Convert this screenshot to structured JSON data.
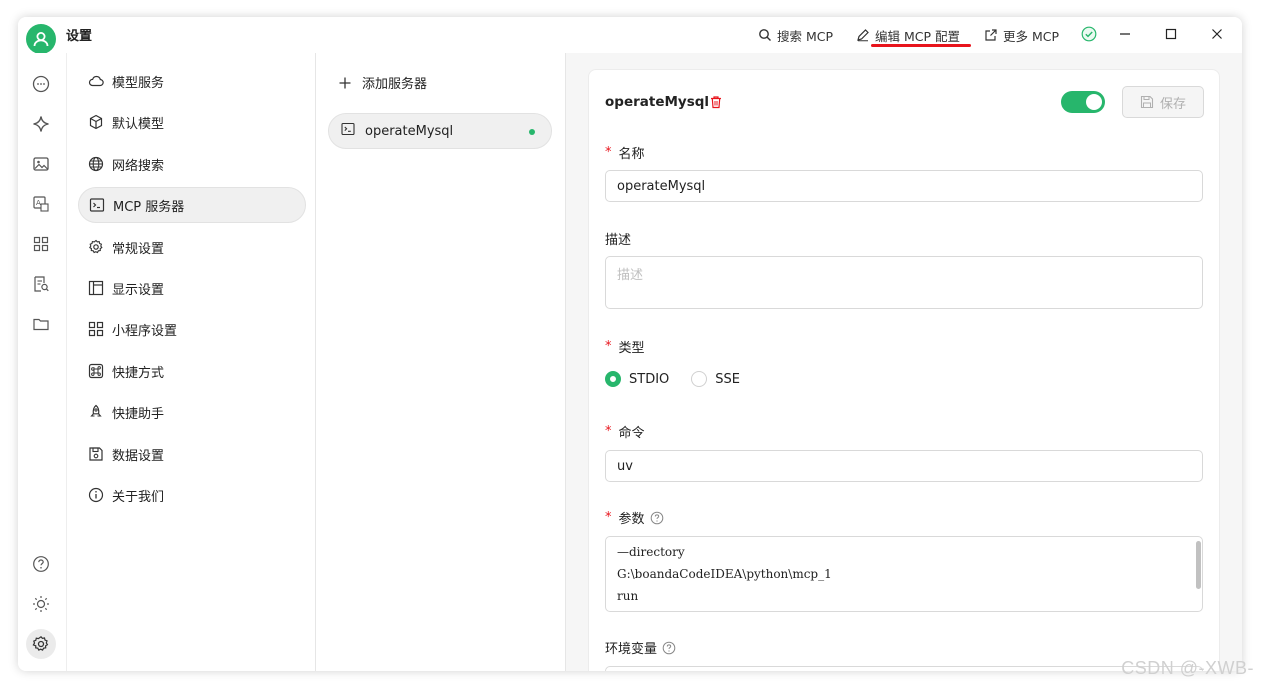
{
  "window": {
    "title": "设置",
    "actions": {
      "search_mcp": "搜索 MCP",
      "edit_mcp": "编辑 MCP 配置",
      "more_mcp": "更多 MCP"
    }
  },
  "menu": {
    "items": [
      {
        "label": "模型服务",
        "icon": "cloud-icon"
      },
      {
        "label": "默认模型",
        "icon": "cube-icon"
      },
      {
        "label": "网络搜索",
        "icon": "globe-icon"
      },
      {
        "label": "MCP 服务器",
        "icon": "terminal-icon"
      },
      {
        "label": "常规设置",
        "icon": "gear-icon"
      },
      {
        "label": "显示设置",
        "icon": "layout-icon"
      },
      {
        "label": "小程序设置",
        "icon": "apps-icon"
      },
      {
        "label": "快捷方式",
        "icon": "command-icon"
      },
      {
        "label": "快捷助手",
        "icon": "rocket-icon"
      },
      {
        "label": "数据设置",
        "icon": "save-icon"
      },
      {
        "label": "关于我们",
        "icon": "info-icon"
      }
    ]
  },
  "servers": {
    "add_label": "添加服务器",
    "items": [
      {
        "name": "operateMysql",
        "status": "active"
      }
    ]
  },
  "form": {
    "title": "operateMysql",
    "enabled": true,
    "save_label": "保存",
    "name_label": "名称",
    "name_value": "operateMysql",
    "desc_label": "描述",
    "desc_placeholder": "描述",
    "type_label": "类型",
    "type_options": [
      "STDIO",
      "SSE"
    ],
    "type_selected": "STDIO",
    "command_label": "命令",
    "command_value": "uv",
    "args_label": "参数",
    "args_lines": [
      "—directory",
      "G:\\boandaCodeIDEA\\python\\mcp_1",
      "run"
    ],
    "env_label": "环境变量"
  },
  "watermark": "CSDN @-XWB-",
  "colors": {
    "accent": "#27b66c",
    "underline": "#e8141c"
  }
}
